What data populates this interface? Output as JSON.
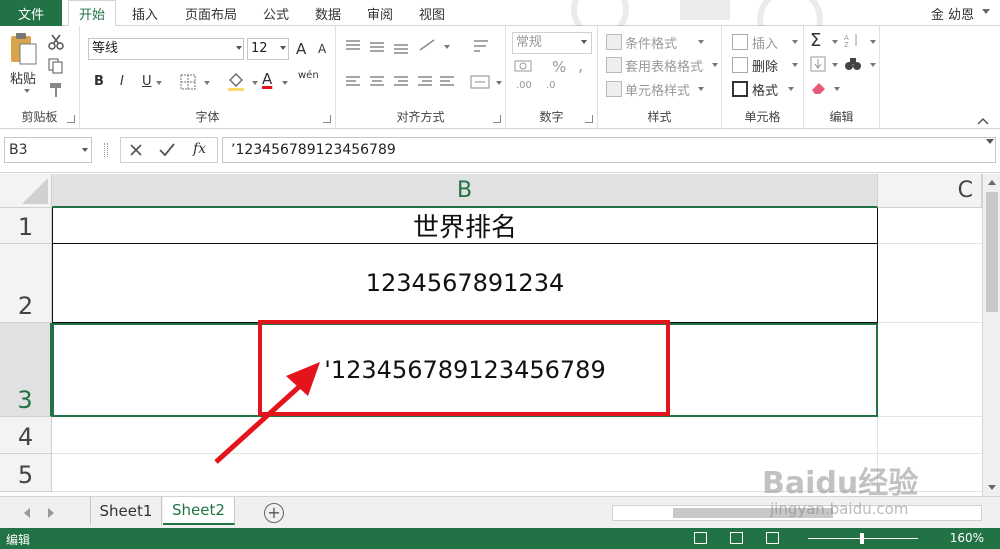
{
  "ribbon_tabs": {
    "file": "文件",
    "home": "开始",
    "insert": "插入",
    "page_layout": "页面布局",
    "formulas": "公式",
    "data": "数据",
    "review": "审阅",
    "view": "视图"
  },
  "user": "金 幼恩",
  "clipboard": {
    "paste": "粘贴",
    "label": "剪贴板"
  },
  "font": {
    "name": "等线",
    "size": "12",
    "bold": "B",
    "italic": "I",
    "underline": "U",
    "font_color_letter": "A",
    "phonetic": "wén",
    "label": "字体",
    "grow": "A",
    "shrink": "A"
  },
  "alignment": {
    "label": "对齐方式"
  },
  "number": {
    "format": "常规",
    "percent": "%",
    "comma": ",",
    "inc_dec": ".00",
    "dec_dec": ".0",
    "label": "数字"
  },
  "styles": {
    "conditional": "条件格式",
    "table": "套用表格格式",
    "cell_styles": "单元格样式",
    "label": "样式"
  },
  "cells": {
    "insert": "插入",
    "delete": "删除",
    "format": "格式",
    "label": "单元格"
  },
  "editing": {
    "sum": "Σ",
    "label": "编辑"
  },
  "formula_bar": {
    "name_box": "B3",
    "fx": "fx",
    "value": "’123456789123456789"
  },
  "columns": [
    "B",
    "C"
  ],
  "rows": [
    "1",
    "2",
    "3",
    "4",
    "5"
  ],
  "cells_data": {
    "B1": "世界排名",
    "B2": "1234567891234",
    "B3": "'123456789123456789"
  },
  "sheets": [
    "Sheet1",
    "Sheet2"
  ],
  "active_sheet": "Sheet2",
  "status": {
    "mode": "编辑",
    "zoom": "160%"
  },
  "watermark": {
    "line1": "Baidu经验",
    "line2": "jingyan.baidu.com"
  },
  "colors": {
    "accent": "#217346",
    "annotation": "#e3141b"
  }
}
